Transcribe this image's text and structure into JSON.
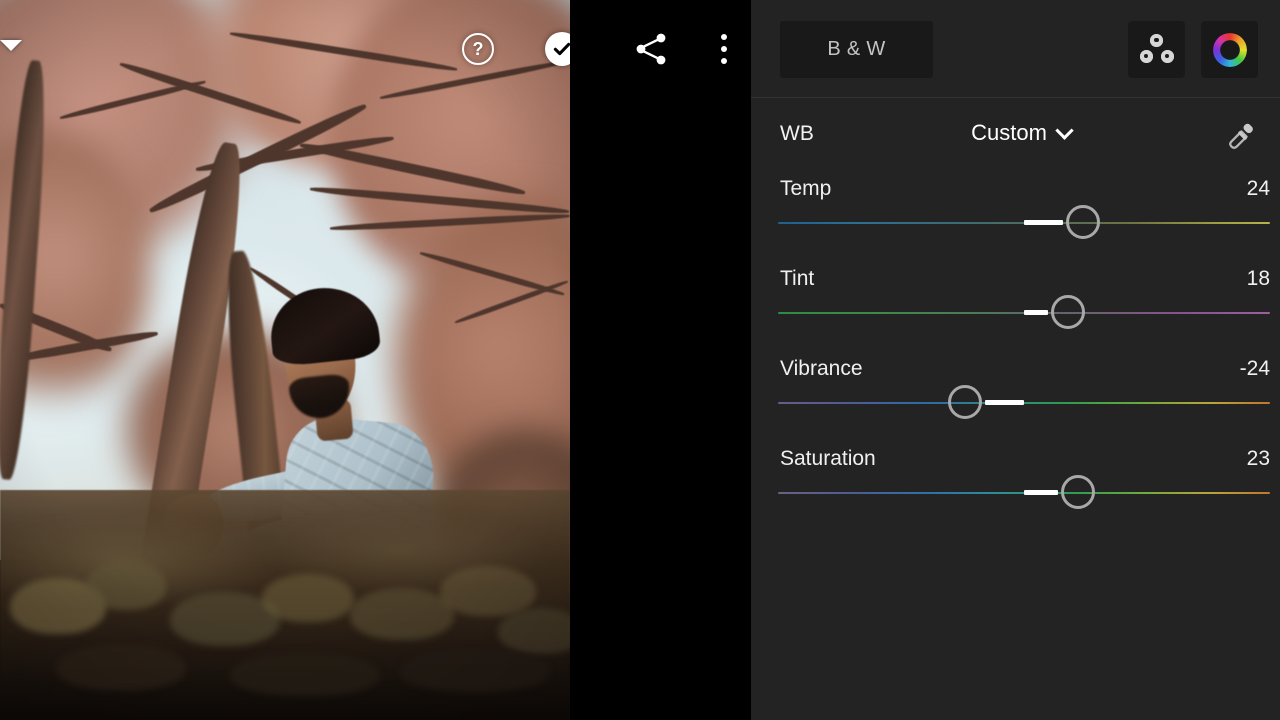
{
  "app": {
    "title": "Photo Editor — Color",
    "panel_bg": "#232323",
    "accent": "#ffffff"
  },
  "photo": {
    "alt": "Young man sitting on the ground leaning against a large bare tree at golden hour",
    "subject": "seated man",
    "scene": "tree, sky, grass",
    "overlay": {
      "collapse_caret": "▼",
      "help_label": "?",
      "confirm_label": "✓"
    }
  },
  "toolbar": {
    "share_label": "Share",
    "more_label": "More options"
  },
  "panel": {
    "bw_button": "B & W",
    "presets_label": "Presets",
    "color_mix_label": "Color Mix",
    "wb": {
      "label": "WB",
      "value": "Custom",
      "chevron": "⌄",
      "eyedropper_label": "Eyedropper"
    },
    "sliders": [
      {
        "name": "Temp",
        "value": "24",
        "pct": 62,
        "track_gradient": "linear-gradient(90deg,#1f5f8f 0%,#2d6e93 16%,#3a6b7a 34%,#4e6b5e 52%,#6f7343 72%,#9a9b44 88%,#b6b34b 100%)"
      },
      {
        "name": "Tint",
        "value": "18",
        "pct": 59,
        "track_gradient": "linear-gradient(90deg,#2f8a43 0%,#3d8a4b 20%,#4d7a58 40%,#5c6a66 52%,#6d5f72 64%,#86558a 82%,#9b5fa0 100%)"
      },
      {
        "name": "Vibrance",
        "value": "-24",
        "pct": 38,
        "track_gradient": "linear-gradient(90deg,#6a5c86 0%,#4f5c93 14%,#2f6aa6 30%,#2e8a84 44%,#2f9a52 58%,#63a83f 72%,#b9a53a 88%,#c2752f 100%)"
      },
      {
        "name": "Saturation",
        "value": "23",
        "pct": 61,
        "track_gradient": "linear-gradient(90deg,#6d5f84 0%,#4a5e95 16%,#2e74a8 32%,#2f8f92 46%,#2f9b54 60%,#6faa3d 74%,#b8a33b 88%,#c2762f 100%)"
      }
    ]
  }
}
